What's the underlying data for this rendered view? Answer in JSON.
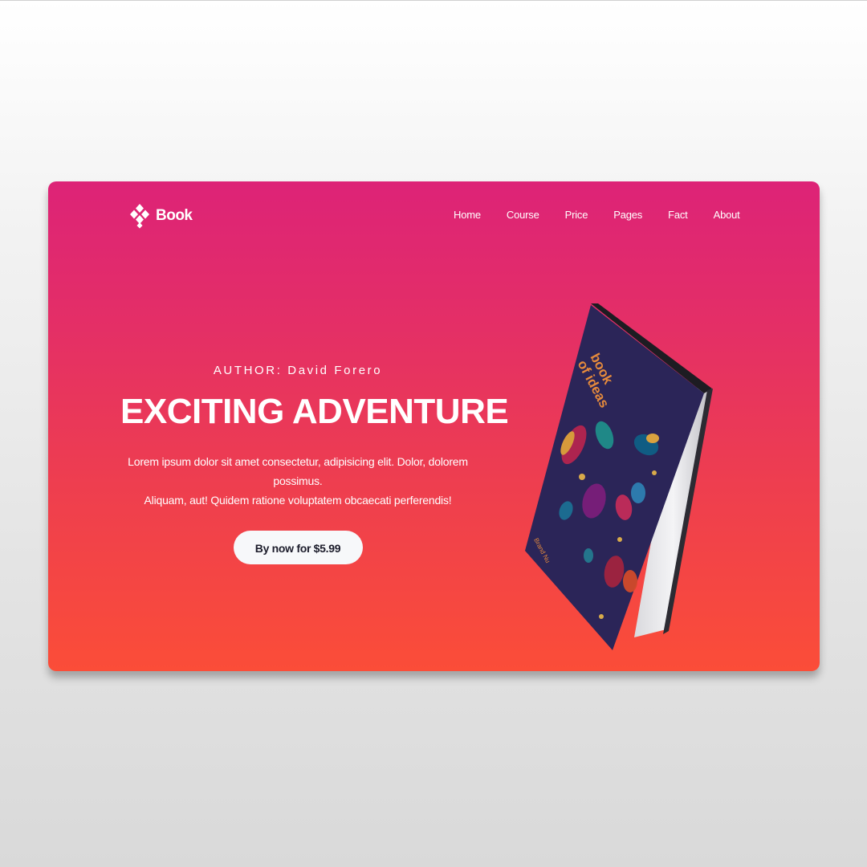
{
  "brand": {
    "name": "Book",
    "logo_icon": "diamond-cluster-icon"
  },
  "nav": {
    "items": [
      {
        "label": "Home"
      },
      {
        "label": "Course"
      },
      {
        "label": "Price"
      },
      {
        "label": "Pages"
      },
      {
        "label": "Fact"
      },
      {
        "label": "About"
      }
    ]
  },
  "hero": {
    "author": "AUTHOR: David Forero",
    "title": "EXCITING ADVENTURE",
    "description_line1": "Lorem ipsum dolor sit amet consectetur, adipisicing elit. Dolor, dolorem possimus.",
    "description_line2": "Aliquam, aut! Quidem ratione voluptatem obcaecati perferendis!",
    "cta_label": "By now for $5.99"
  },
  "book": {
    "title_line1": "book",
    "title_line2": "of ideas",
    "author": "Brand Nu"
  },
  "colors": {
    "gradient_top": "#dd2377",
    "gradient_bottom": "#fb4d38",
    "book_cover": "#2b2558",
    "button_bg": "#f7f8fa",
    "button_text": "#1c1c2b"
  }
}
